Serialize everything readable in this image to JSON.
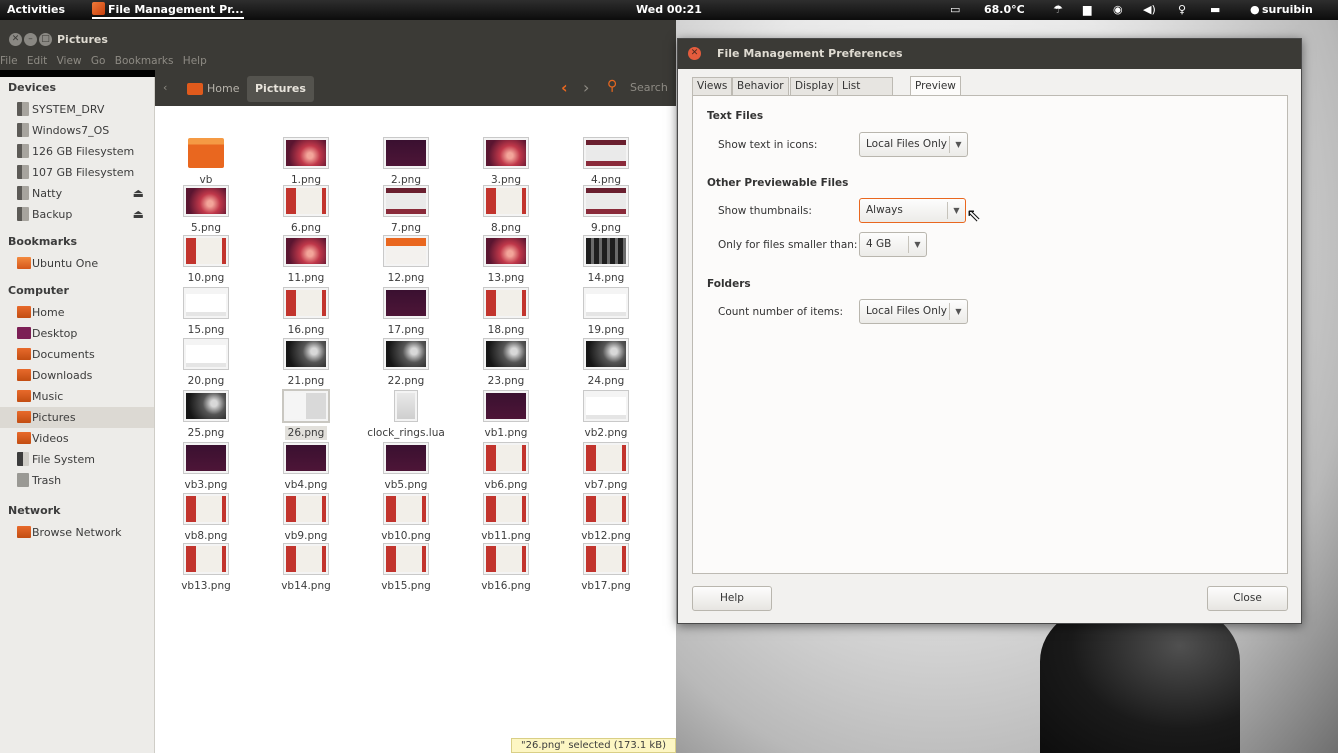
{
  "topbar": {
    "activities": "Activities",
    "app_menu": "File Management Pr...",
    "clock": "Wed 00:21",
    "temperature": "68.0°C",
    "username": "suruibin",
    "icons": [
      "keyboard-icon",
      "weather-icon",
      "folder-icon",
      "ubuntu-one-icon",
      "volume-icon",
      "network-icon",
      "battery-icon",
      "user-status-icon"
    ]
  },
  "nautilus": {
    "title": "Pictures",
    "menu": [
      "File",
      "Edit",
      "View",
      "Go",
      "Bookmarks",
      "Help"
    ],
    "pathbar": {
      "home": "Home",
      "current": "Pictures",
      "search": "Search"
    },
    "sidebar": {
      "devices_header": "Devices",
      "devices": [
        "SYSTEM_DRV",
        "Windows7_OS",
        "126 GB Filesystem",
        "107 GB Filesystem",
        "Natty",
        "Backup"
      ],
      "bookmarks_header": "Bookmarks",
      "bookmarks": [
        "Ubuntu One"
      ],
      "computer_header": "Computer",
      "computer": [
        "Home",
        "Desktop",
        "Documents",
        "Downloads",
        "Music",
        "Pictures",
        "Videos",
        "File System",
        "Trash"
      ],
      "network_header": "Network",
      "network": [
        "Browse Network"
      ]
    },
    "files": [
      "vb",
      "1.png",
      "2.png",
      "3.png",
      "4.png",
      "5.png",
      "6.png",
      "7.png",
      "8.png",
      "9.png",
      "10.png",
      "11.png",
      "12.png",
      "13.png",
      "14.png",
      "15.png",
      "16.png",
      "17.png",
      "18.png",
      "19.png",
      "20.png",
      "21.png",
      "22.png",
      "23.png",
      "24.png",
      "25.png",
      "26.png",
      "clock_rings.lua",
      "vb1.png",
      "vb2.png",
      "vb3.png",
      "vb4.png",
      "vb5.png",
      "vb6.png",
      "vb7.png",
      "vb8.png",
      "vb9.png",
      "vb10.png",
      "vb11.png",
      "vb12.png",
      "vb13.png",
      "vb14.png",
      "vb15.png",
      "vb16.png",
      "vb17.png"
    ],
    "selected_file": "26.png",
    "status": "\"26.png\" selected (173.1 kB)"
  },
  "prefs": {
    "title": "File Management Preferences",
    "tabs": [
      "Views",
      "Behavior",
      "Display",
      "List Columns",
      "Preview"
    ],
    "active_tab": "Preview",
    "text_files": {
      "header": "Text Files",
      "show_text_label": "Show text in icons:",
      "show_text_value": "Local Files Only"
    },
    "other_files": {
      "header": "Other Previewable Files",
      "thumbnails_label": "Show thumbnails:",
      "thumbnails_value": "Always",
      "size_label": "Only for files smaller than:",
      "size_value": "4 GB"
    },
    "folders": {
      "header": "Folders",
      "count_label": "Count number of items:",
      "count_value": "Local Files Only"
    },
    "help_button": "Help",
    "close_button": "Close"
  },
  "colors": {
    "accent": "#e9671f",
    "panel_dark": "#3b3a36",
    "sidebar_bg": "#edece9",
    "status_bg": "#fdf6c3"
  }
}
